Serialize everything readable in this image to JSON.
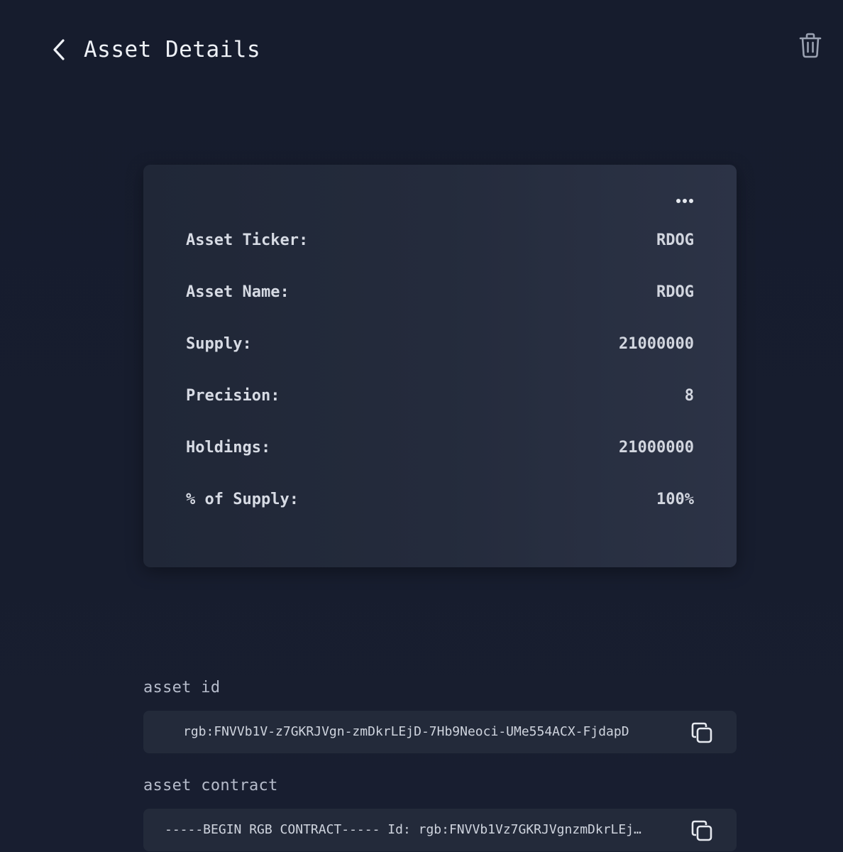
{
  "header": {
    "title": "Asset Details",
    "back_icon": "chevron-left-icon",
    "delete_icon": "trash-icon"
  },
  "card": {
    "menu_icon": "more-horizontal-icon",
    "rows": [
      {
        "label": "Asset Ticker:",
        "value": "RDOG"
      },
      {
        "label": "Asset Name:",
        "value": "RDOG"
      },
      {
        "label": "Supply:",
        "value": "21000000"
      },
      {
        "label": "Precision:",
        "value": "8"
      },
      {
        "label": "Holdings:",
        "value": "21000000"
      },
      {
        "label": "% of Supply:",
        "value": "100%"
      }
    ]
  },
  "asset_id": {
    "label": "asset id",
    "value": "rgb:FNVVb1V-z7GKRJVgn-zmDkrLEjD-7Hb9Neoci-UMe554ACX-FjdapD",
    "copy_icon": "copy-icon"
  },
  "asset_contract": {
    "label": "asset contract",
    "value": "-----BEGIN RGB CONTRACT----- Id: rgb:FNVVb1Vz7GKRJVgnzmDkrLEj…",
    "copy_icon": "copy-icon"
  },
  "colors": {
    "background": "#161c2c",
    "card": "#242b3c",
    "field": "#232a3a",
    "text": "#e6e9ef",
    "muted": "#b6bccb"
  }
}
